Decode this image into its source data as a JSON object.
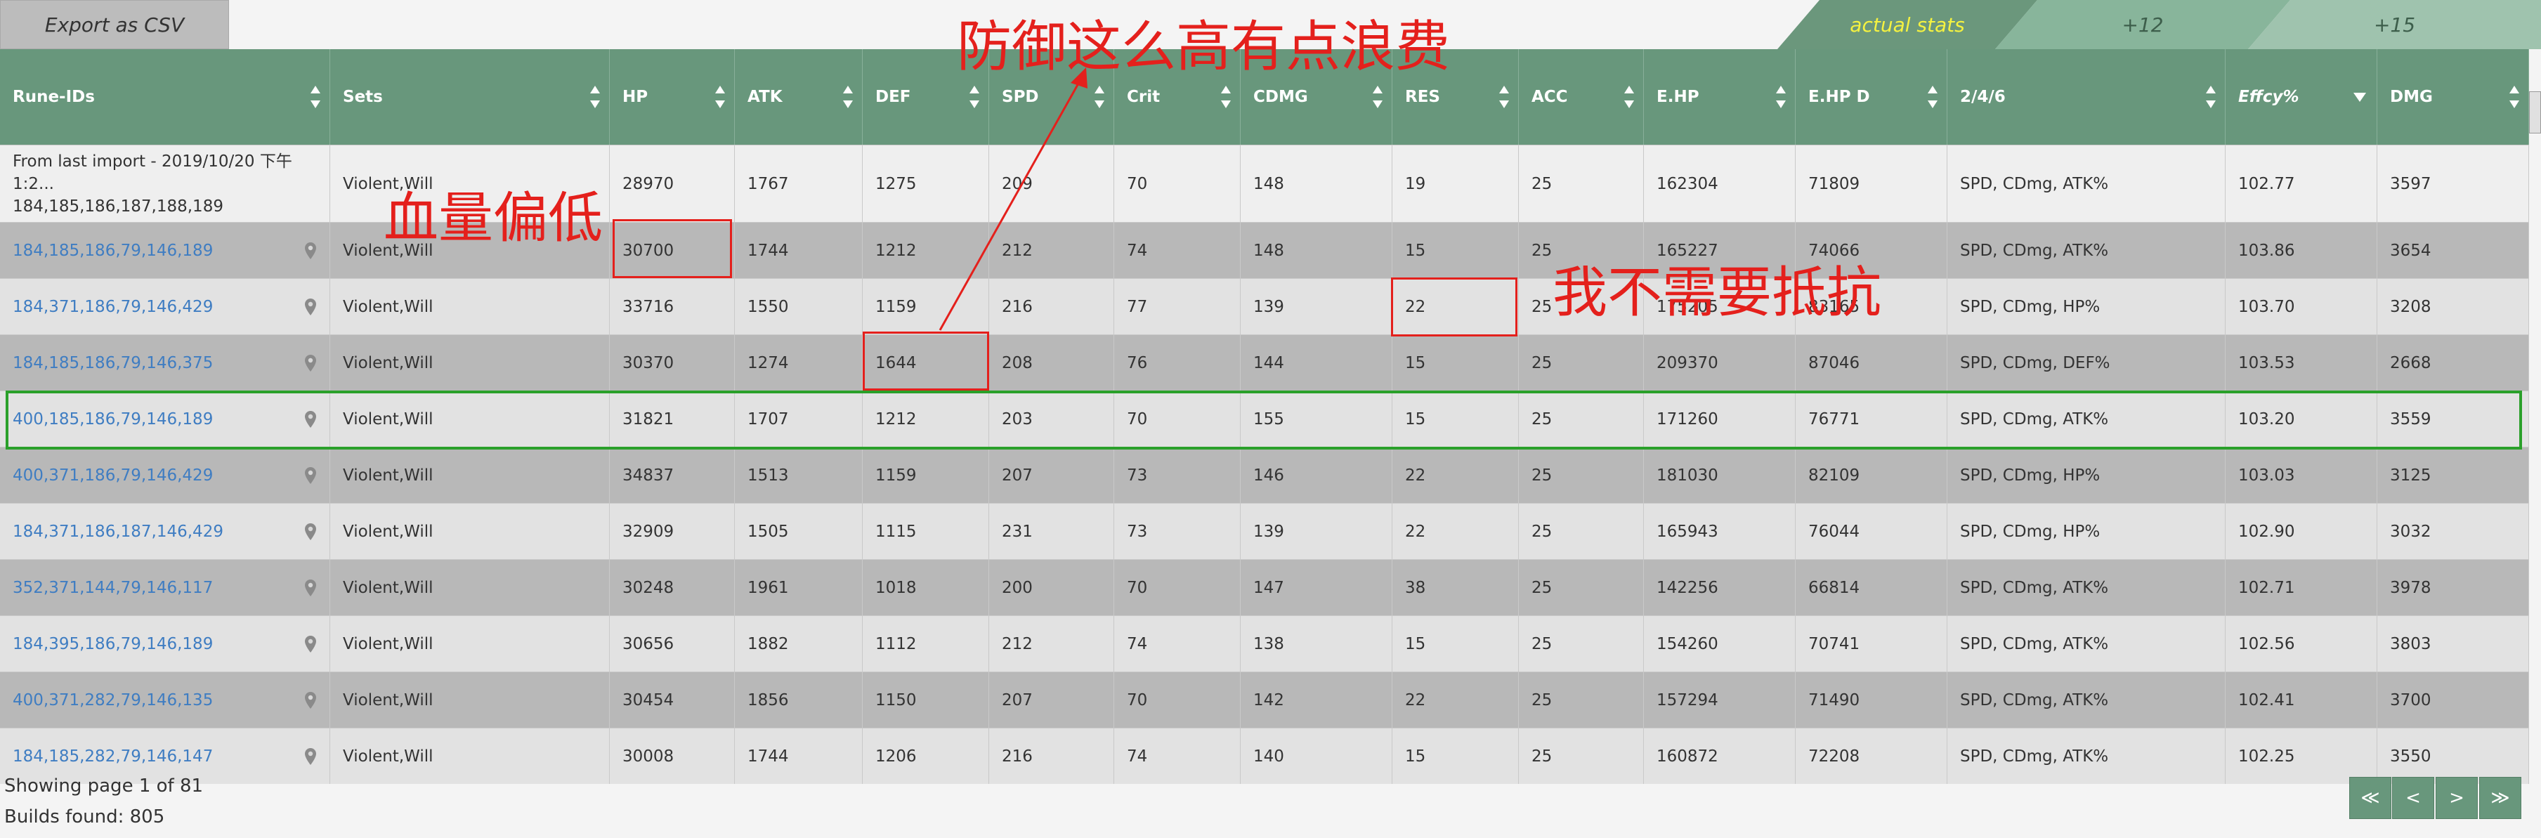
{
  "toolbar": {
    "export_label": "Export as CSV"
  },
  "tabs": [
    "actual stats",
    "+12",
    "+15"
  ],
  "columns": [
    "Rune-IDs",
    "Sets",
    "HP",
    "ATK",
    "DEF",
    "SPD",
    "Crit",
    "CDMG",
    "RES",
    "ACC",
    "E.HP",
    "E.HP D",
    "2/4/6",
    "Effcy%",
    "DMG"
  ],
  "first_row": {
    "rune_ids_line1": "From last import - 2019/10/20 下午1:2...",
    "rune_ids_line2": "184,185,186,187,188,189",
    "values": [
      "Violent,Will",
      "28970",
      "1767",
      "1275",
      "209",
      "70",
      "148",
      "19",
      "25",
      "162304",
      "71809",
      "SPD, CDmg, ATK%",
      "102.77",
      "3597"
    ]
  },
  "rows": [
    [
      "184,185,186,79,146,189",
      "Violent,Will",
      "30700",
      "1744",
      "1212",
      "212",
      "74",
      "148",
      "15",
      "25",
      "165227",
      "74066",
      "SPD, CDmg, ATK%",
      "103.86",
      "3654"
    ],
    [
      "184,371,186,79,146,429",
      "Violent,Will",
      "33716",
      "1550",
      "1159",
      "216",
      "77",
      "139",
      "22",
      "25",
      "175205",
      "83165",
      "SPD, CDmg, HP%",
      "103.70",
      "3208"
    ],
    [
      "184,185,186,79,146,375",
      "Violent,Will",
      "30370",
      "1274",
      "1644",
      "208",
      "76",
      "144",
      "15",
      "25",
      "209370",
      "87046",
      "SPD, CDmg, DEF%",
      "103.53",
      "2668"
    ],
    [
      "400,185,186,79,146,189",
      "Violent,Will",
      "31821",
      "1707",
      "1212",
      "203",
      "70",
      "155",
      "15",
      "25",
      "171260",
      "76771",
      "SPD, CDmg, ATK%",
      "103.20",
      "3559"
    ],
    [
      "400,371,186,79,146,429",
      "Violent,Will",
      "34837",
      "1513",
      "1159",
      "207",
      "73",
      "146",
      "22",
      "25",
      "181030",
      "82109",
      "SPD, CDmg, HP%",
      "103.03",
      "3125"
    ],
    [
      "184,371,186,187,146,429",
      "Violent,Will",
      "32909",
      "1505",
      "1115",
      "231",
      "73",
      "139",
      "22",
      "25",
      "165943",
      "76044",
      "SPD, CDmg, HP%",
      "102.90",
      "3032"
    ],
    [
      "352,371,144,79,146,117",
      "Violent,Will",
      "30248",
      "1961",
      "1018",
      "200",
      "70",
      "147",
      "38",
      "25",
      "142256",
      "66814",
      "SPD, CDmg, ATK%",
      "102.71",
      "3978"
    ],
    [
      "184,395,186,79,146,189",
      "Violent,Will",
      "30656",
      "1882",
      "1112",
      "212",
      "74",
      "138",
      "15",
      "25",
      "154260",
      "70741",
      "SPD, CDmg, ATK%",
      "102.56",
      "3803"
    ],
    [
      "400,371,282,79,146,135",
      "Violent,Will",
      "30454",
      "1856",
      "1150",
      "207",
      "70",
      "142",
      "22",
      "25",
      "157294",
      "71490",
      "SPD, CDmg, ATK%",
      "102.41",
      "3700"
    ],
    [
      "184,185,282,79,146,147",
      "Violent,Will",
      "30008",
      "1744",
      "1206",
      "216",
      "74",
      "140",
      "15",
      "25",
      "160872",
      "72208",
      "SPD, CDmg, ATK%",
      "102.25",
      "3550"
    ]
  ],
  "footer": {
    "page_info": "Showing page 1 of 81",
    "builds_found": "Builds found: 805"
  },
  "pager": [
    "≪",
    "<",
    ">",
    "≫"
  ],
  "annotations": {
    "def_note": "防御这么高有点浪费",
    "hp_note": "血量偏低",
    "res_note": "我不需要抵抗"
  },
  "colors": {
    "header": "#68977c",
    "link": "#3f7dc2",
    "annotation": "#e4201c",
    "highlight": "#2aa02a",
    "row_dark": "#b8b8b8",
    "row_light": "#e2e2e2"
  }
}
